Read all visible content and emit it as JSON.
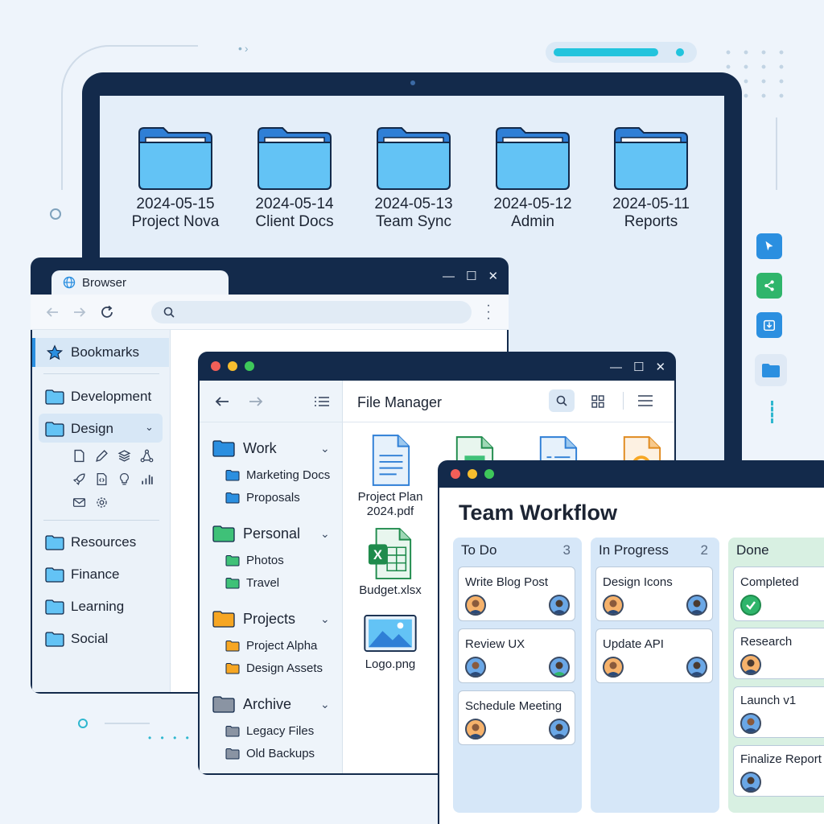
{
  "colors": {
    "navy": "#132a4b",
    "folder_blue": "#63c3f5",
    "folder_dark": "#2f7fd6",
    "accent_cyan": "#22c4dd",
    "rail_blue": "#2b8fe0",
    "rail_green": "#2fb56b",
    "green_folder": "#3fc178",
    "orange_folder": "#f6a623",
    "gray_folder": "#8a94a3"
  },
  "desktop": {
    "folders": [
      {
        "date": "2024-05-15",
        "name": "Project Nova"
      },
      {
        "date": "2024-05-14",
        "name": "Client Docs"
      },
      {
        "date": "2024-05-13",
        "name": "Team Sync"
      },
      {
        "date": "2024-05-12",
        "name": "Admin"
      },
      {
        "date": "2024-05-11",
        "name": "Reports"
      }
    ]
  },
  "rail": {
    "icons": [
      "cursor-icon",
      "share-icon",
      "download-icon",
      "folder-icon"
    ]
  },
  "browser": {
    "tab_title": "Browser",
    "window_controls": [
      "—",
      "☐",
      "✕"
    ],
    "bookmarks_label": "Bookmarks",
    "items": {
      "development": "Development",
      "design": "Design",
      "resources": "Resources",
      "finance": "Finance",
      "learning": "Learning",
      "social": "Social"
    },
    "design_icons": [
      "document-icon",
      "pen-icon",
      "layers-icon",
      "nodes-icon",
      "rocket-icon",
      "code-file-icon",
      "bulb-icon",
      "bar-chart-icon",
      "mail-icon",
      "gear-icon"
    ]
  },
  "file_manager": {
    "title": "File Manager",
    "window_controls": [
      "—",
      "☐",
      "✕"
    ],
    "groups": {
      "work": {
        "label": "Work",
        "items": [
          "Marketing Docs",
          "Proposals"
        ]
      },
      "personal": {
        "label": "Personal",
        "items": [
          "Photos",
          "Travel"
        ]
      },
      "projects": {
        "label": "Projects",
        "items": [
          "Project Alpha",
          "Design Assets"
        ]
      },
      "archive": {
        "label": "Archive",
        "items": [
          "Legacy Files",
          "Old Backups"
        ]
      }
    },
    "files": {
      "plan_line1": "Project Plan",
      "plan_line2": "2024.pdf",
      "budget": "Budget.xlsx",
      "logo": "Logo.png"
    }
  },
  "kanban": {
    "title": "Team Workflow",
    "columns": {
      "todo": {
        "label": "To Do",
        "count": "3",
        "cards": [
          "Write Blog Post",
          "Review UX",
          "Schedule Meeting"
        ]
      },
      "progress": {
        "label": "In Progress",
        "count": "2",
        "cards": [
          "Design Icons",
          "Update API"
        ]
      },
      "done": {
        "label": "Done",
        "cards": [
          "Completed",
          "Research",
          "Launch v1",
          "Finalize Report"
        ]
      }
    }
  }
}
